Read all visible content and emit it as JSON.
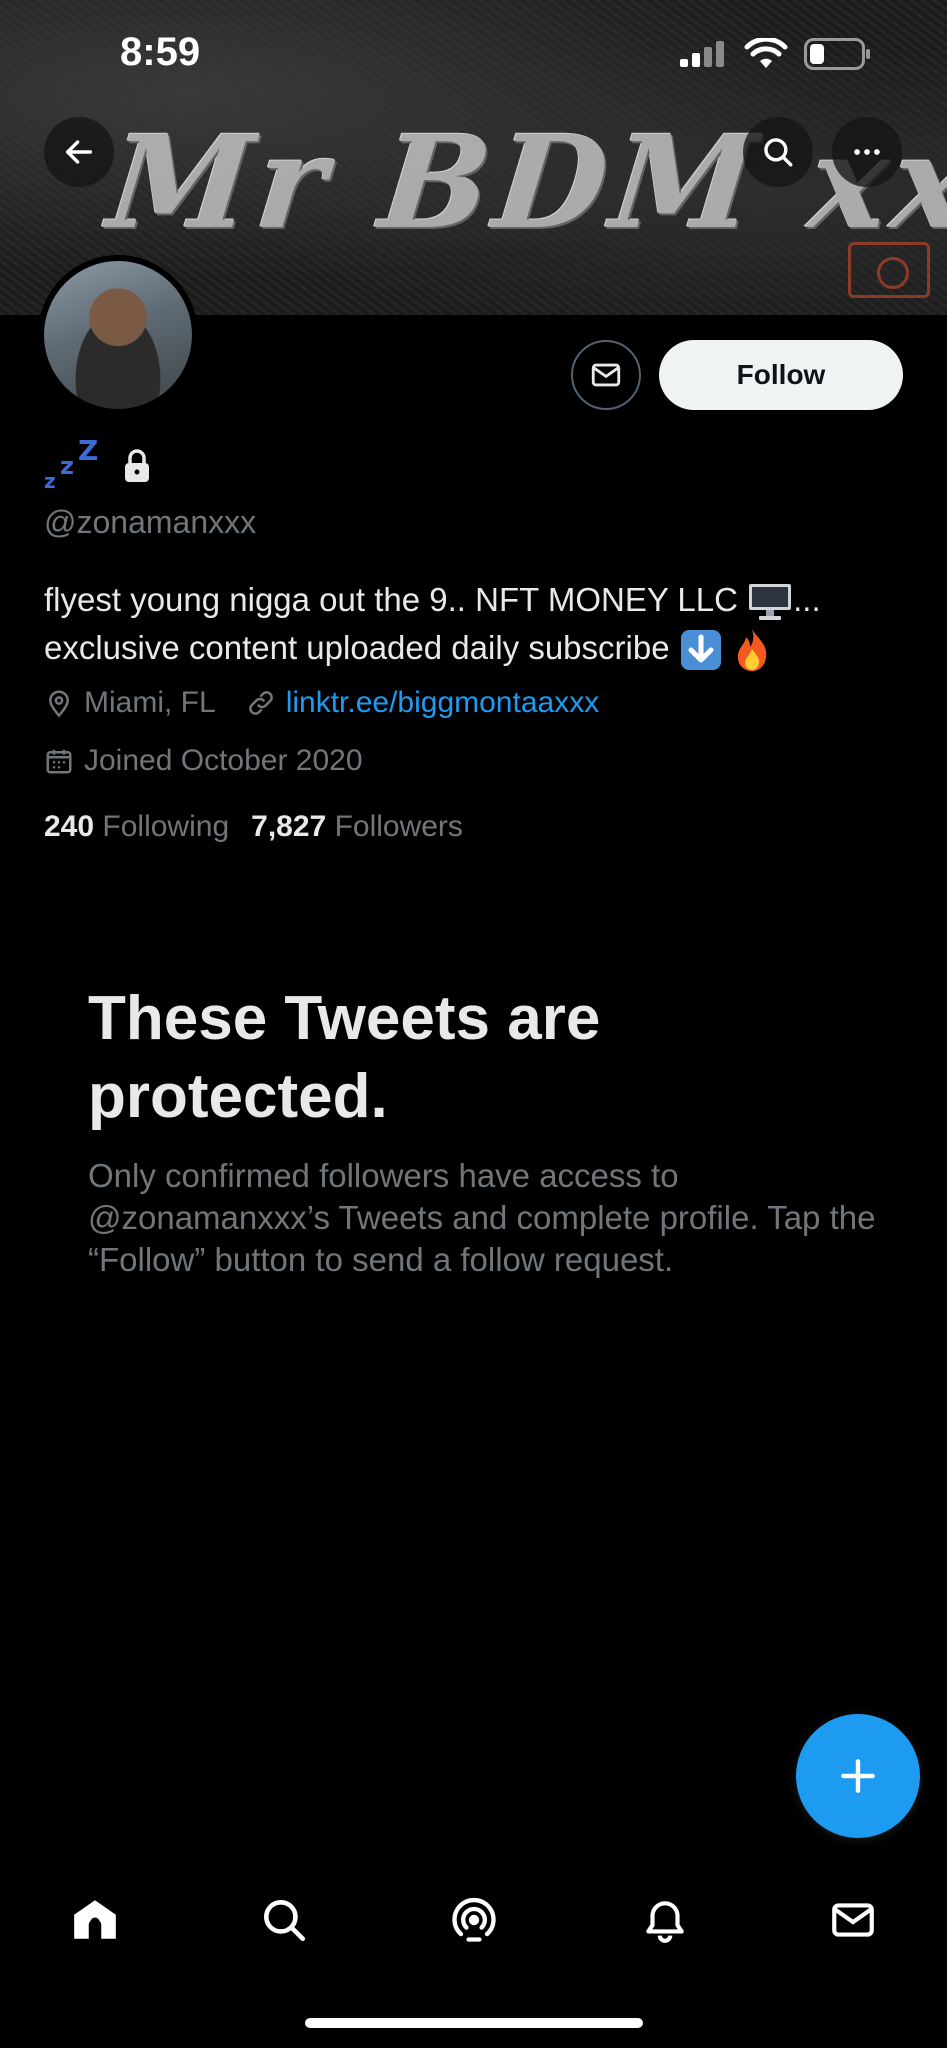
{
  "status_bar": {
    "time": "8:59"
  },
  "banner": {
    "text": "Mr BDM xxx"
  },
  "header": {
    "back_icon": "arrow-left-icon",
    "search_icon": "search-icon",
    "more_icon": "more-horizontal-icon"
  },
  "profile": {
    "display_name_emoji": "💤",
    "locked": true,
    "handle": "@zonamanxxx",
    "bio_line1": "flyest young nigga out the 9.. NFT MONEY LLC",
    "bio_line1_suffix": "...",
    "bio_line2": "exclusive content uploaded daily subscribe",
    "location": "Miami, FL",
    "website": "linktr.ee/biggmontaaxxx",
    "joined": "Joined October 2020",
    "following_count": "240",
    "following_label": "Following",
    "followers_count": "7,827",
    "followers_label": "Followers"
  },
  "actions": {
    "follow_label": "Follow",
    "message_icon": "mail-icon"
  },
  "protected": {
    "title": "These Tweets are protected.",
    "body": "Only confirmed followers have access to @zonamanxxx’s Tweets and complete profile. Tap the “Follow” button to send a follow request."
  },
  "fab": {
    "icon": "plus-icon"
  },
  "tabbar": {
    "items": [
      "home-icon",
      "search-icon",
      "spaces-icon",
      "notifications-icon",
      "messages-icon"
    ]
  },
  "colors": {
    "accent": "#1d9bf0",
    "background": "#000000",
    "secondary_text": "#71767b"
  }
}
